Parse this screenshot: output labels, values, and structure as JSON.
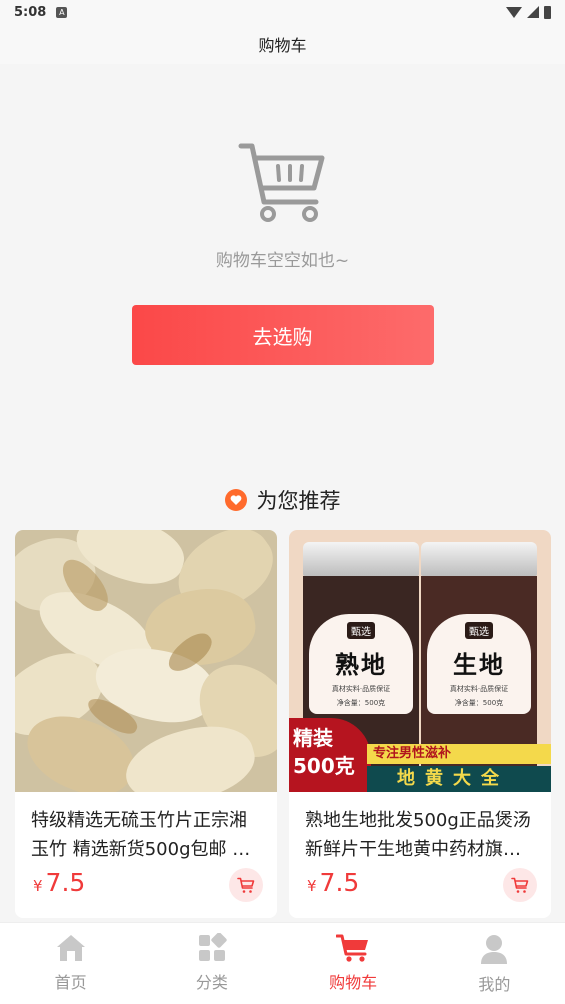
{
  "status_bar": {
    "time": "5:08",
    "notif_icon": "A"
  },
  "header": {
    "title": "购物车"
  },
  "empty": {
    "message": "购物车空空如也~",
    "button_label": "去选购"
  },
  "recommend": {
    "title": "为您推荐",
    "products": [
      {
        "name": "特级精选无硫玉竹片正宗湘玉竹 精选新货500g包邮 …",
        "currency": "¥",
        "price": "7.5"
      },
      {
        "name": "熟地生地批发500g正品煲汤新鲜片干生地黄中药材旗…",
        "currency": "¥",
        "price": "7.5",
        "image_text": {
          "jar1_tag": "甄选",
          "jar1_name": "熟地",
          "jar2_tag": "甄选",
          "jar2_name": "生地",
          "jar_small": "真材实料·品质保证",
          "jar_weight": "净含量：500克",
          "badge_line1": "精装",
          "badge_line2": "500克",
          "strip_yellow": "专注男性滋补",
          "strip_teal": "地黄大全"
        }
      }
    ]
  },
  "nav": [
    {
      "label": "首页",
      "icon": "home-icon"
    },
    {
      "label": "分类",
      "icon": "category-icon"
    },
    {
      "label": "购物车",
      "icon": "cart-icon",
      "active": true
    },
    {
      "label": "我的",
      "icon": "user-icon"
    }
  ],
  "colors": {
    "accent": "#f03a3a",
    "button_start": "#fb4848",
    "button_end": "#fd6b6b",
    "heart_badge": "#ff6a2c"
  }
}
